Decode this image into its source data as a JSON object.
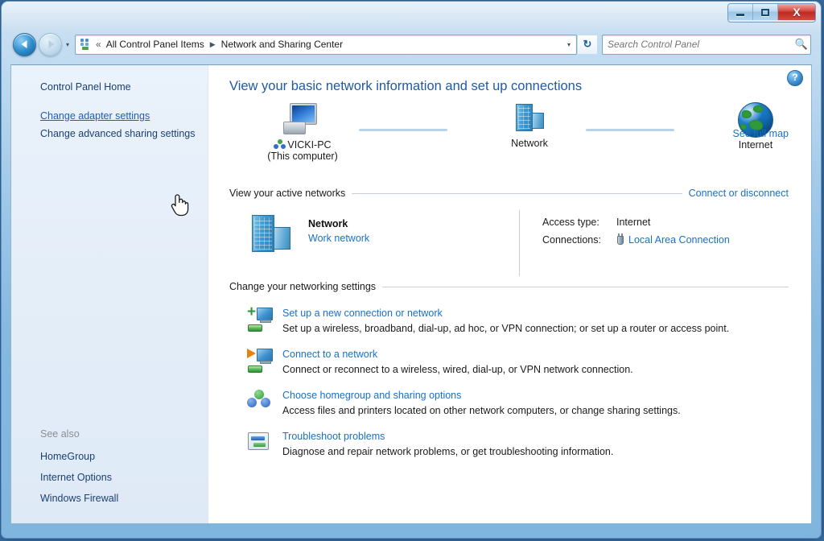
{
  "window": {
    "controls": {
      "minimize": "Minimize",
      "maximize": "Maximize",
      "close": "X"
    }
  },
  "navigation": {
    "back_label": "Back",
    "forward_label": "Forward",
    "history_dropdown": "▾",
    "breadcrumb_chevrons": "«",
    "crumbs": [
      {
        "label": "All Control Panel Items"
      },
      {
        "label": "Network and Sharing Center"
      }
    ],
    "crumb_separator": "▶",
    "address_dropdown": "▾",
    "refresh_label": "↻",
    "control_panel_icon": "control-panel-icon"
  },
  "search": {
    "placeholder": "Search Control Panel",
    "value": "",
    "icon": "search-icon"
  },
  "sidebar": {
    "home_label": "Control Panel Home",
    "links": [
      {
        "label": "Change adapter settings",
        "hovered": true
      },
      {
        "label": "Change advanced sharing settings",
        "hovered": false
      }
    ],
    "see_also_title": "See also",
    "see_also": [
      {
        "label": "HomeGroup"
      },
      {
        "label": "Internet Options"
      },
      {
        "label": "Windows Firewall"
      }
    ]
  },
  "content": {
    "help_glyph": "?",
    "page_title": "View your basic network information and set up connections",
    "network_map": {
      "see_full_map": "See full map",
      "nodes": [
        {
          "label": "VICKI-PC",
          "sub": "(This computer)",
          "icon": "computer-icon"
        },
        {
          "label": "Network",
          "sub": "",
          "icon": "server-icon"
        },
        {
          "label": "Internet",
          "sub": "",
          "icon": "globe-icon"
        }
      ]
    },
    "active_networks": {
      "heading": "View your active networks",
      "action": "Connect or disconnect",
      "network_name": "Network",
      "network_type": "Work network",
      "details": [
        {
          "key": "Access type:",
          "value": "Internet",
          "is_link": false
        },
        {
          "key": "Connections:",
          "value": "Local Area Connection",
          "is_link": true
        }
      ]
    },
    "change_settings": {
      "heading": "Change your networking settings",
      "items": [
        {
          "title": "Set up a new connection or network",
          "desc": "Set up a wireless, broadband, dial-up, ad hoc, or VPN connection; or set up a router or access point.",
          "icon": "new-connection-icon"
        },
        {
          "title": "Connect to a network",
          "desc": "Connect or reconnect to a wireless, wired, dial-up, or VPN network connection.",
          "icon": "connect-network-icon"
        },
        {
          "title": "Choose homegroup and sharing options",
          "desc": "Access files and printers located on other network computers, or change sharing settings.",
          "icon": "homegroup-icon"
        },
        {
          "title": "Troubleshoot problems",
          "desc": "Diagnose and repair network problems, or get troubleshooting information.",
          "icon": "troubleshoot-icon"
        }
      ]
    }
  },
  "colors": {
    "link": "#1a70c5",
    "title": "#1f5aa6",
    "close_button": "#bd2b22",
    "sidebar_bg": "#e4eef9"
  }
}
